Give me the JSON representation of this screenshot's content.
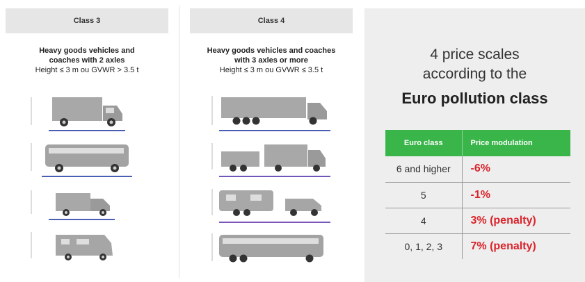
{
  "class3": {
    "header": "Class 3",
    "title": "Heavy goods vehicles and coaches with 2 axles",
    "subtitle": "Height ≤ 3 m ou GVWR > 3.5 t",
    "vehicles": [
      "truck-2-axles",
      "coach-2-axles",
      "pickup-van",
      "motorhome"
    ]
  },
  "class4": {
    "header": "Class 4",
    "title": "Heavy goods vehicles and coaches with 3 axles or more",
    "subtitle": "Height ≤ 3 m ou GVWR ≤ 3.5 t",
    "vehicles": [
      "articulated-truck",
      "truck-with-trailer",
      "van-with-caravan",
      "coach-3-axles"
    ]
  },
  "headline": {
    "line1": "4 price scales",
    "line2": "according to the",
    "line3": "Euro pollution class"
  },
  "pricing_table": {
    "headers": [
      "Euro class",
      "Price modulation"
    ],
    "rows": [
      {
        "euro": "6 and higher",
        "mod": "-6%"
      },
      {
        "euro": "5",
        "mod": "-1%"
      },
      {
        "euro": "4",
        "mod": "3% (penalty)"
      },
      {
        "euro": "0, 1, 2, 3",
        "mod": "7% (penalty)"
      }
    ]
  },
  "colors": {
    "header_green": "#39b54a",
    "modulation_red": "#d9242b",
    "panel_gray": "#eeeeee",
    "vehicle_gray": "#9e9e9e"
  }
}
